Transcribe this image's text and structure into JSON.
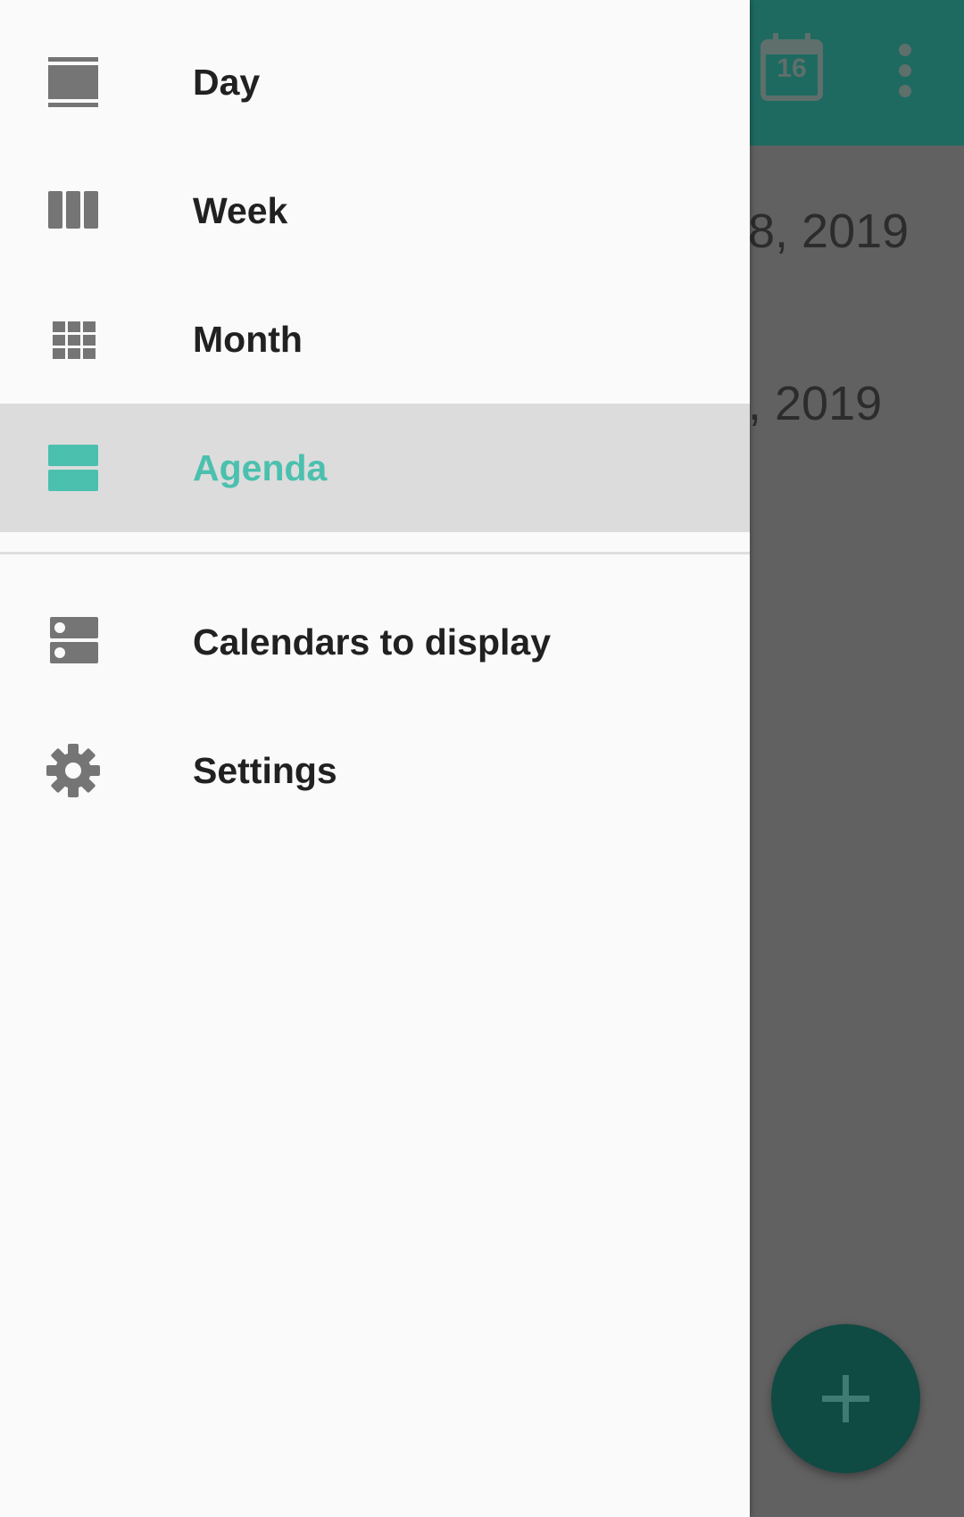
{
  "background": {
    "calendar_today_day": "16",
    "agenda_dates": [
      "8, 2019",
      ", 2019"
    ],
    "fab_label": "+"
  },
  "drawer": {
    "items": [
      {
        "label": "Day",
        "icon": "day-view-icon"
      },
      {
        "label": "Week",
        "icon": "week-view-icon"
      },
      {
        "label": "Month",
        "icon": "month-view-icon"
      },
      {
        "label": "Agenda",
        "icon": "agenda-view-icon",
        "selected": true
      }
    ],
    "secondary_items": [
      {
        "label": "Calendars to display",
        "icon": "calendars-icon"
      },
      {
        "label": "Settings",
        "icon": "gear-icon"
      }
    ]
  },
  "colors": {
    "toolbar": "#1e6a61",
    "accent": "#4bc0ae",
    "fab": "#0f4a43",
    "icon_gray": "#757575"
  }
}
